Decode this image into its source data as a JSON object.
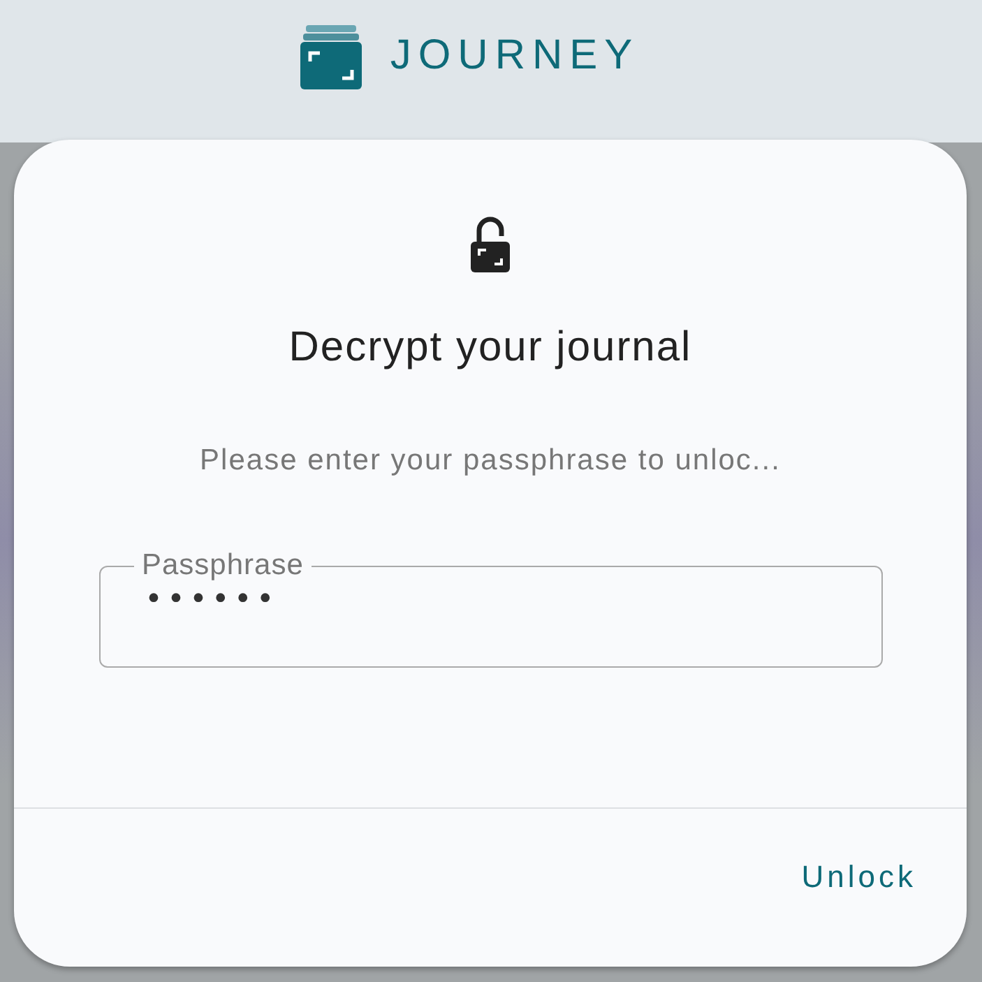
{
  "header": {
    "brand": "JOURNEY"
  },
  "dialog": {
    "title": "Decrypt your journal",
    "message": "Please enter your passphrase to unloc...",
    "field": {
      "label": "Passphrase",
      "value": "••••••"
    },
    "buttons": [
      "Unlock"
    ]
  }
}
